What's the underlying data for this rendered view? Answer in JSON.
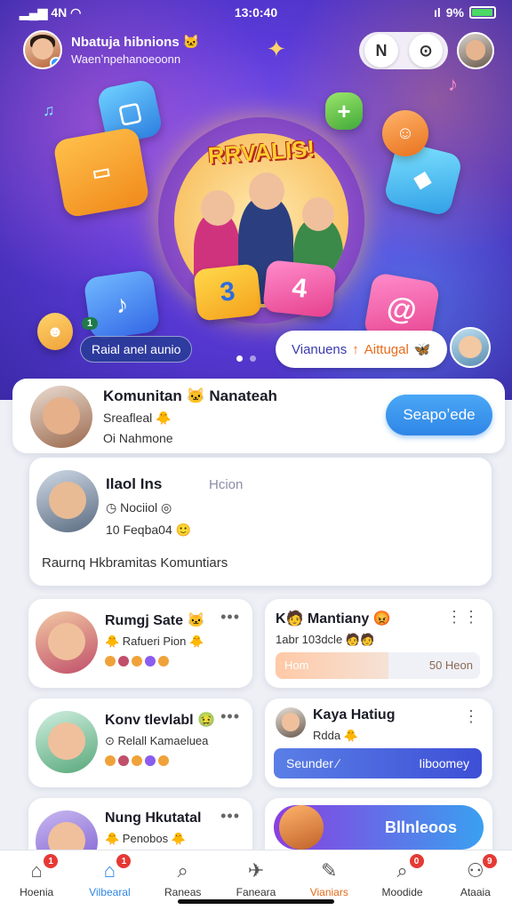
{
  "status_bar": {
    "signal": "4N",
    "time": "13:0:40",
    "battery": "9%"
  },
  "header": {
    "title": "Nbatuja hibnions",
    "emoji": "🐱",
    "subtitle": "Waenʼnpehanoeoonn",
    "toggle_left": "N",
    "toggle_right": "⊙"
  },
  "hero": {
    "banner_title": "RRVALIS!",
    "tile_left": "3",
    "tile_right": "4",
    "badge": "1",
    "tag_label": "Raial anel aunio",
    "cta_label": "Vianuens",
    "cta_icon": "↑",
    "cta_accent": "Aittugal",
    "cta_emoji": "🦋",
    "slide_count": 2,
    "active_slide": 0
  },
  "featured": {
    "title": "Komunitan 🐱 Nanateah",
    "line1": "Sreafleal 🐥",
    "line2": "Oi Nahmone",
    "button_label": "Seapoʼede"
  },
  "post": {
    "title": "Ilaol Ins",
    "tag": "Hcion",
    "line1": "◷ Nociiol ◎",
    "line2": "10 Feqba04 🙂",
    "body": "Raurnq Hkbramitas Komuntiars"
  },
  "cards": [
    {
      "title": "Rumgj Sate 🐱",
      "sub": "🐥 Rafueri Pion 🐥",
      "more": "•••"
    },
    {
      "title": "K🧑 Mantiany 😡",
      "sub": "1abr 103dcle 🧑🧑",
      "more": "⋮⋮",
      "progress_label": "Hom",
      "progress_value": "50 Heon",
      "progress_fraction": 0.55
    },
    {
      "title": "Konv tlevlabl 🤢",
      "sub": "⊙ Relall Kamaeluea",
      "more": "•••"
    },
    {
      "title": "Kaya Hatiug",
      "sub": "Rdda 🐥",
      "more": "⋮",
      "button_left": "Seunder ∕",
      "button_right": "Iiboomey"
    },
    {
      "title": "Nung Hkutatal",
      "sub": "🐥 Penobos 🐥",
      "more": "•••"
    },
    {
      "promo_label": "Bllnleoos"
    }
  ],
  "nav": [
    {
      "label": "Hoenia",
      "icon": "home-icon",
      "glyph": "⌂",
      "badge": "1"
    },
    {
      "label": "Vilbearal",
      "icon": "home-filled-icon",
      "glyph": "⌂",
      "badge": "1"
    },
    {
      "label": "Raneas",
      "icon": "search-icon",
      "glyph": "⌕",
      "badge": ""
    },
    {
      "label": "Faneara",
      "icon": "bird-icon",
      "glyph": "✈",
      "badge": ""
    },
    {
      "label": "Vianiars",
      "icon": "edit-icon",
      "glyph": "✎",
      "badge": ""
    },
    {
      "label": "Moodide",
      "icon": "search-icon",
      "glyph": "⌕",
      "badge": "0"
    },
    {
      "label": "Ataaia",
      "icon": "profile-icon",
      "glyph": "⚇",
      "badge": "9"
    }
  ],
  "colors": {
    "accent": "#2f86e6",
    "hero": "#5a3ad8",
    "orange": "#e86b1a",
    "badge": "#e53935"
  }
}
